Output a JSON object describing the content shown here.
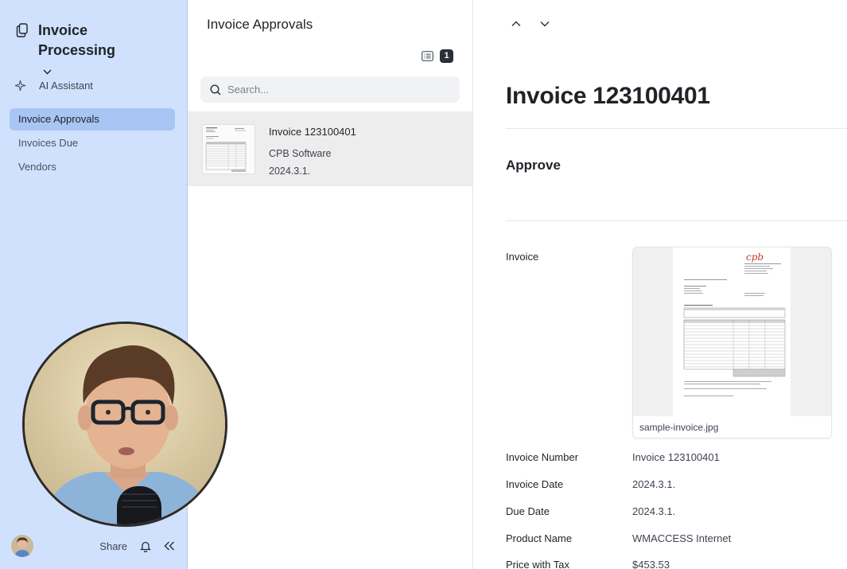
{
  "app": {
    "name": "Invoice Processing"
  },
  "sidebar": {
    "ai_label": "AI Assistant",
    "items": [
      {
        "label": "Invoice Approvals",
        "active": true
      },
      {
        "label": "Invoices Due",
        "active": false
      },
      {
        "label": "Vendors",
        "active": false
      }
    ],
    "footer": {
      "share_label": "Share"
    }
  },
  "list": {
    "title": "Invoice Approvals",
    "count": "1",
    "search_placeholder": "Search...",
    "rows": [
      {
        "title": "Invoice 123100401",
        "vendor": "CPB Software",
        "date": "2024.3.1."
      }
    ]
  },
  "detail": {
    "title": "Invoice 123100401",
    "section": "Approve",
    "attachment_label": "Invoice",
    "attachment": {
      "filename": "sample-invoice.jpg",
      "logo_text": "cpb"
    },
    "fields": [
      {
        "label": "Invoice Number",
        "value": "Invoice 123100401"
      },
      {
        "label": "Invoice Date",
        "value": "2024.3.1."
      },
      {
        "label": "Due Date",
        "value": "2024.3.1."
      },
      {
        "label": "Product Name",
        "value": "WMACCESS Internet"
      },
      {
        "label": "Price with Tax",
        "value": "$453.53"
      }
    ]
  },
  "colors": {
    "sidebar_bg": "#cfe1fd",
    "active_item": "#a9c5f3",
    "selected_row": "#ededee",
    "logo": "#c0392b"
  }
}
